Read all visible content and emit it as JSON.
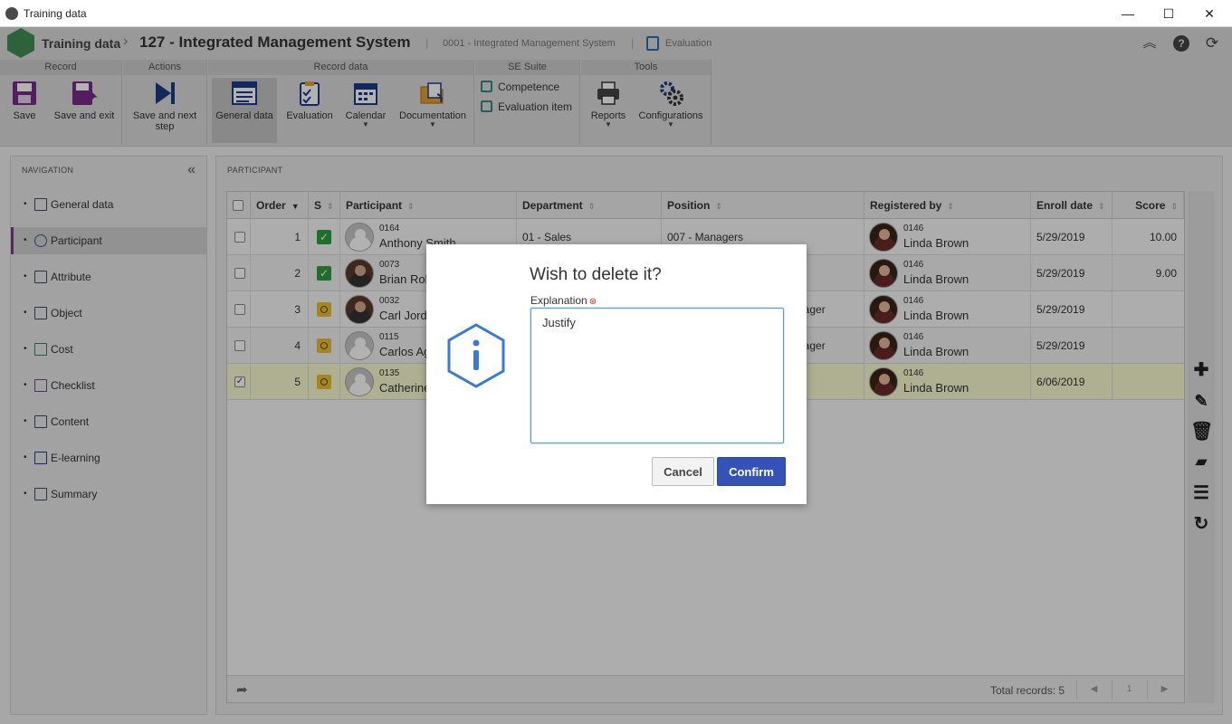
{
  "window": {
    "title": "Training data",
    "controls": [
      "—",
      "☐",
      "✕"
    ]
  },
  "header": {
    "crumb1": "Training data",
    "crumb2": "127 - Integrated Management System",
    "sub1": "0001 - Integrated Management System",
    "sub2": "Evaluation",
    "sep": "|"
  },
  "ribbon": {
    "groups": {
      "record": "Record",
      "actions": "Actions",
      "record_data": "Record data",
      "se_suite": "SE Suite",
      "tools": "Tools"
    },
    "buttons": {
      "save": "Save",
      "save_exit": "Save and exit",
      "save_next": "Save and next step",
      "general_data": "General data",
      "evaluation": "Evaluation",
      "calendar": "Calendar",
      "documentation": "Documentation",
      "reports": "Reports",
      "configurations": "Configurations"
    },
    "links": {
      "competence": "Competence",
      "evaluation_item": "Evaluation item"
    }
  },
  "navigation": {
    "heading": "NAVIGATION",
    "items": [
      {
        "label": "General data"
      },
      {
        "label": "Participant"
      },
      {
        "label": "Attribute"
      },
      {
        "label": "Object"
      },
      {
        "label": "Cost"
      },
      {
        "label": "Checklist"
      },
      {
        "label": "Content"
      },
      {
        "label": "E-learning"
      },
      {
        "label": "Summary"
      }
    ],
    "active": "Participant"
  },
  "panel": {
    "heading": "PARTICIPANT",
    "columns": {
      "order": "Order",
      "s": "S",
      "participant": "Participant",
      "department": "Department",
      "position": "Position",
      "registered_by": "Registered by",
      "enroll_date": "Enroll date",
      "score": "Score"
    },
    "rows": [
      {
        "order": "1",
        "status": "done",
        "code": "0164",
        "name": "Anthony Smith",
        "department": "01 - Sales",
        "position": "007 - Managers",
        "reg_code": "0146",
        "reg_name": "Linda Brown",
        "enroll": "5/29/2019",
        "score": "10.00",
        "checked": false
      },
      {
        "order": "2",
        "status": "done",
        "code": "0073",
        "name": "Brian Rob",
        "department": "",
        "position": "",
        "reg_code": "0146",
        "reg_name": "Linda Brown",
        "enroll": "5/29/2019",
        "score": "9.00",
        "checked": false
      },
      {
        "order": "3",
        "status": "pending",
        "code": "0032",
        "name": "Carl Jord",
        "department": "",
        "position": "nager",
        "reg_code": "0146",
        "reg_name": "Linda Brown",
        "enroll": "5/29/2019",
        "score": "",
        "checked": false
      },
      {
        "order": "4",
        "status": "pending",
        "code": "0115",
        "name": "Carlos Ag",
        "department": "",
        "position": "nager",
        "reg_code": "0146",
        "reg_name": "Linda Brown",
        "enroll": "5/29/2019",
        "score": "",
        "checked": false
      },
      {
        "order": "5",
        "status": "pending",
        "code": "0135",
        "name": "Catherine",
        "department": "",
        "position": "",
        "reg_code": "0146",
        "reg_name": "Linda Brown",
        "enroll": "6/06/2019",
        "score": "",
        "checked": true
      }
    ],
    "footer": {
      "total": "Total records: 5",
      "page": "1"
    }
  },
  "dialog": {
    "title": "Wish to delete it?",
    "field_label": "Explanation",
    "field_value": "Justify",
    "cancel": "Cancel",
    "confirm": "Confirm"
  },
  "colors": {
    "accent": "#3552b8",
    "status_done": "#2e9e3e",
    "status_pending": "#e8c030",
    "selected_row": "#fbfbd0",
    "nav_active_marker": "#7a3d8c"
  }
}
